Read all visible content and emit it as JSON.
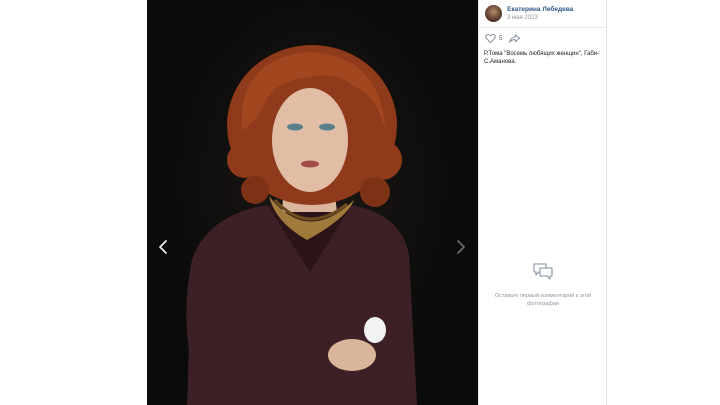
{
  "photo": {
    "description_icon": "theatre-portrait-photo"
  },
  "navigation": {
    "prev_icon": "chevron-left-icon",
    "next_icon": "chevron-right-icon"
  },
  "post": {
    "author_name": "Екатерина Лебедева",
    "date": "3 мая 2023",
    "likes": "5",
    "caption": "Р.Тома \"Восемь любящих женщин\", Габи-С.Аманова."
  },
  "comments": {
    "empty_text": "Оставьте первый комментарий к этой фотографии"
  },
  "colors": {
    "link": "#2a5885",
    "muted": "#939393",
    "viewer_bg": "#0b0b0b"
  }
}
